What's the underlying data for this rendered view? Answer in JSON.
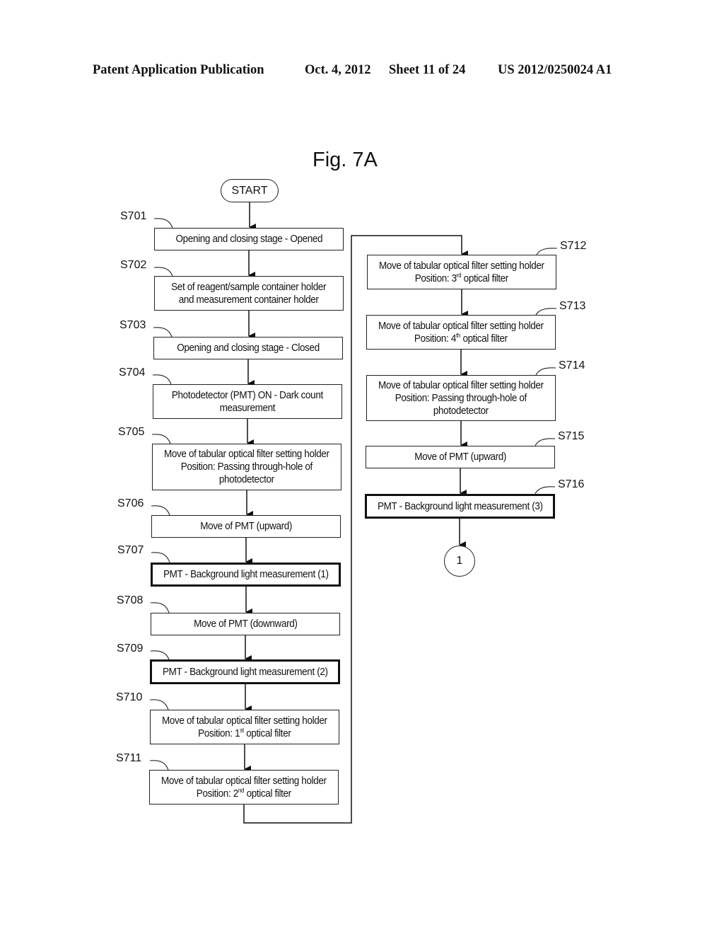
{
  "header": {
    "publication": "Patent Application Publication",
    "date": "Oct. 4, 2012",
    "sheet": "Sheet 11 of 24",
    "number": "US 2012/0250024 A1"
  },
  "figure": {
    "title": "Fig. 7A",
    "start_label": "START",
    "end_connector_label": "1"
  },
  "steps": [
    {
      "id": "S701",
      "lines": [
        "Opening and closing stage - Opened"
      ],
      "emphasized": false
    },
    {
      "id": "S702",
      "lines": [
        "Set of reagent/sample container holder",
        "and measurement container holder"
      ],
      "emphasized": false
    },
    {
      "id": "S703",
      "lines": [
        "Opening and closing stage - Closed"
      ],
      "emphasized": false
    },
    {
      "id": "S704",
      "lines": [
        "Photodetector (PMT)  ON - Dark count",
        "measurement"
      ],
      "emphasized": false
    },
    {
      "id": "S705",
      "lines": [
        "Move of tabular optical filter setting holder",
        "Position: Passing through-hole of",
        "photodetector"
      ],
      "emphasized": false
    },
    {
      "id": "S706",
      "lines": [
        "Move of PMT (upward)"
      ],
      "emphasized": false
    },
    {
      "id": "S707",
      "lines": [
        "PMT - Background light measurement (1)"
      ],
      "emphasized": true
    },
    {
      "id": "S708",
      "lines": [
        "Move of PMT (downward)"
      ],
      "emphasized": false
    },
    {
      "id": "S709",
      "lines": [
        "PMT - Background light measurement (2)"
      ],
      "emphasized": true
    },
    {
      "id": "S710",
      "lines": [
        "Move of tabular optical filter setting holder",
        "Position: 1|st| optical filter"
      ],
      "emphasized": false
    },
    {
      "id": "S711",
      "lines": [
        "Move of tabular optical filter setting holder",
        "Position: 2|nd| optical filter"
      ],
      "emphasized": false
    },
    {
      "id": "S712",
      "lines": [
        "Move of tabular optical filter setting holder",
        "Position: 3|rd| optical filter"
      ],
      "emphasized": false
    },
    {
      "id": "S713",
      "lines": [
        "Move of tabular optical filter setting holder",
        "Position: 4|th| optical filter"
      ],
      "emphasized": false
    },
    {
      "id": "S714",
      "lines": [
        "Move of tabular optical filter setting holder",
        "Position: Passing through-hole of",
        "photodetector"
      ],
      "emphasized": false
    },
    {
      "id": "S715",
      "lines": [
        "Move of PMT (upward)"
      ],
      "emphasized": false
    },
    {
      "id": "S716",
      "lines": [
        "PMT - Background light measurement (3)"
      ],
      "emphasized": true
    }
  ]
}
